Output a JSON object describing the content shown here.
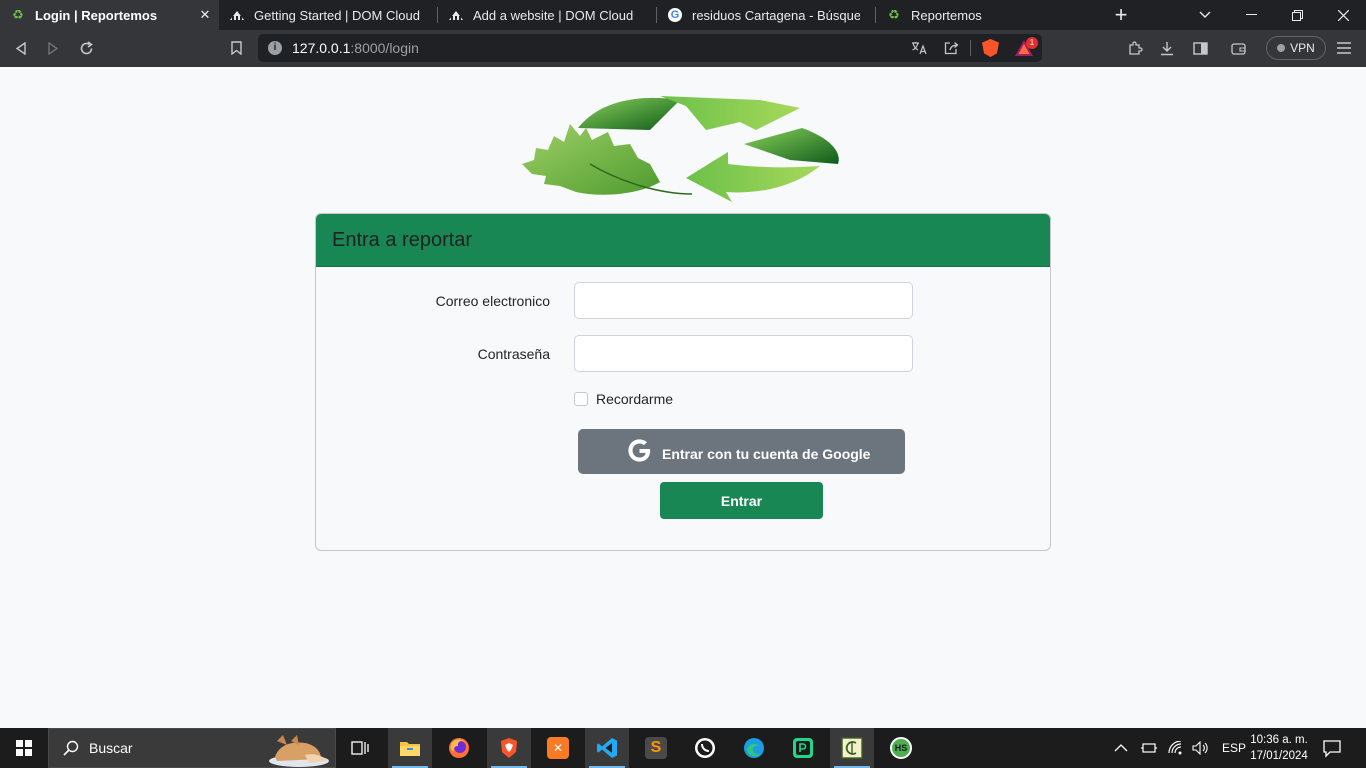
{
  "browser": {
    "tabs": [
      {
        "title": "Login | Reportemos",
        "favicon": "recycle-icon",
        "active": true
      },
      {
        "title": "Getting Started | DOM Cloud",
        "favicon": "domcloud-icon",
        "active": false
      },
      {
        "title": "Add a website | DOM Cloud",
        "favicon": "domcloud-icon",
        "active": false
      },
      {
        "title": "residuos Cartagena - Búsqueda de",
        "favicon": "google-icon",
        "active": false
      },
      {
        "title": "Reportemos",
        "favicon": "recycle-icon",
        "active": false
      }
    ],
    "close_glyph": "✕",
    "new_tab_glyph": "+",
    "url": {
      "host": "127.0.0.1",
      "rest": ":8000/login"
    },
    "rewards_badge": "1",
    "vpn_label": "VPN",
    "info_glyph": "i"
  },
  "page": {
    "card_title": "Entra a reportar",
    "email_label": "Correo electronico",
    "email_value": "",
    "password_label": "Contraseña",
    "password_value": "",
    "remember_label": "Recordarme",
    "google_button_label": "Entrar con tu cuenta de Google",
    "submit_label": "Entrar",
    "colors": {
      "primary": "#198754",
      "secondary": "#6c757d",
      "page_bg": "#f8f9fa"
    }
  },
  "taskbar": {
    "search_label": "Buscar",
    "apps": [
      {
        "name": "task-view",
        "icon": "task-view-icon"
      },
      {
        "name": "file-explorer",
        "icon": "folder-icon"
      },
      {
        "name": "firefox",
        "icon": "firefox-icon"
      },
      {
        "name": "brave",
        "icon": "brave-icon"
      },
      {
        "name": "xampp",
        "icon": "xampp-icon"
      },
      {
        "name": "vscode",
        "icon": "vscode-icon"
      },
      {
        "name": "sublime-text",
        "icon": "sublime-icon"
      },
      {
        "name": "whatsapp",
        "icon": "whatsapp-icon"
      },
      {
        "name": "edge",
        "icon": "edge-icon"
      },
      {
        "name": "pycharm",
        "icon": "pycharm-icon"
      },
      {
        "name": "app-ce",
        "icon": "ce-icon"
      },
      {
        "name": "app-hs",
        "icon": "hs-icon"
      }
    ],
    "language": "ESP",
    "time": "10:36 a. m.",
    "date": "17/01/2024"
  }
}
